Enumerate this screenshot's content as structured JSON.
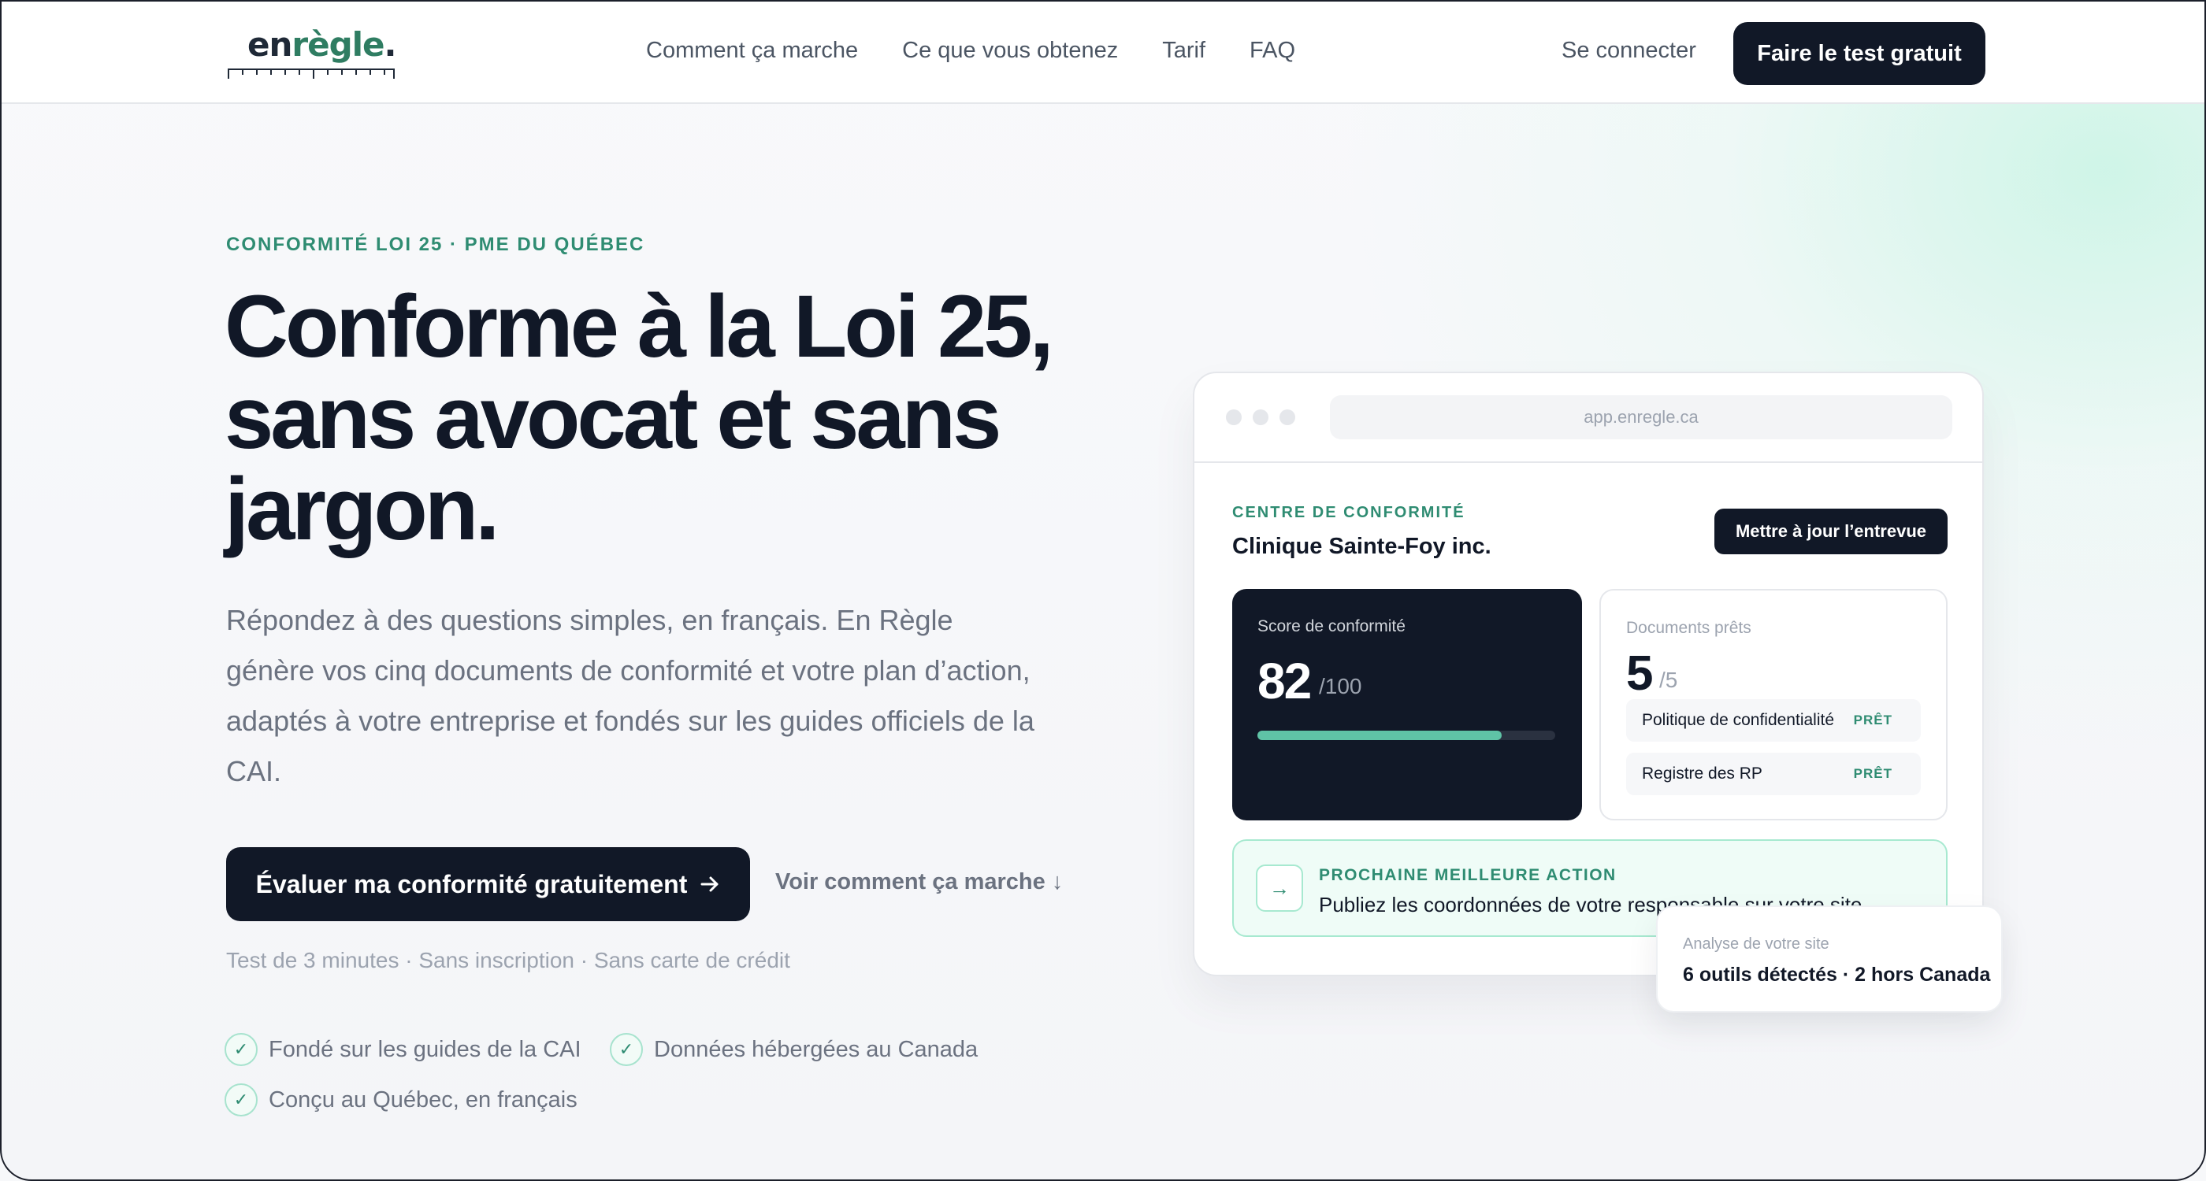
{
  "brand": {
    "logo_plain": "en",
    "logo_accent": "règle",
    "logo_dot": "."
  },
  "nav": {
    "items": [
      "Comment ça marche",
      "Ce que vous obtenez",
      "Tarif",
      "FAQ"
    ],
    "login": "Se connecter",
    "cta": "Faire le test gratuit"
  },
  "hero": {
    "eyebrow": "CONFORMITÉ LOI 25 · PME DU QUÉBEC",
    "title_lines": [
      "Conforme à la Loi 25,",
      "sans avocat et sans",
      "jargon."
    ],
    "subtitle": "Répondez à des questions simples, en français. En Règle génère vos cinq documents de conformité et votre plan d’action, adaptés à votre entreprise et fondés sur les guides officiels de la CAI.",
    "cta_main": "Évaluer ma conformité gratuitement",
    "cta_main_icon": "arrow-right-icon",
    "cta_secondary": "Voir comment ça marche ↓",
    "fineprint": "Test de 3 minutes · Sans inscription · Sans carte de crédit",
    "features": [
      "Fondé sur les guides de la CAI",
      "Données hébergées au Canada",
      "Conçu au Québec, en français"
    ]
  },
  "mock": {
    "url": "app.enregle.ca",
    "eyebrow": "CENTRE DE CONFORMITÉ",
    "company": "Clinique Sainte-Foy inc.",
    "button": "Mettre à jour l’entrevue",
    "score": {
      "label": "Score de conformité",
      "value": "82",
      "max": "/100",
      "progress": 0.82
    },
    "docs": {
      "label": "Documents prêts",
      "value": "5",
      "max": "/5",
      "rows": [
        {
          "name": "Politique de confidentialité",
          "status": "PRÊT"
        },
        {
          "name": "Registre des RP",
          "status": "PRÊT"
        }
      ]
    },
    "next_action": {
      "eyebrow": "PROCHAINE MEILLEURE ACTION",
      "text": "Publiez les coordonnées de votre responsable sur votre site"
    }
  },
  "site_analysis": {
    "label": "Analyse de votre site",
    "value": "6 outils détectés · 2 hors Canada"
  },
  "colors": {
    "accent": "#2f8c72",
    "dark": "#111827",
    "mint": "#5fc3a6"
  }
}
